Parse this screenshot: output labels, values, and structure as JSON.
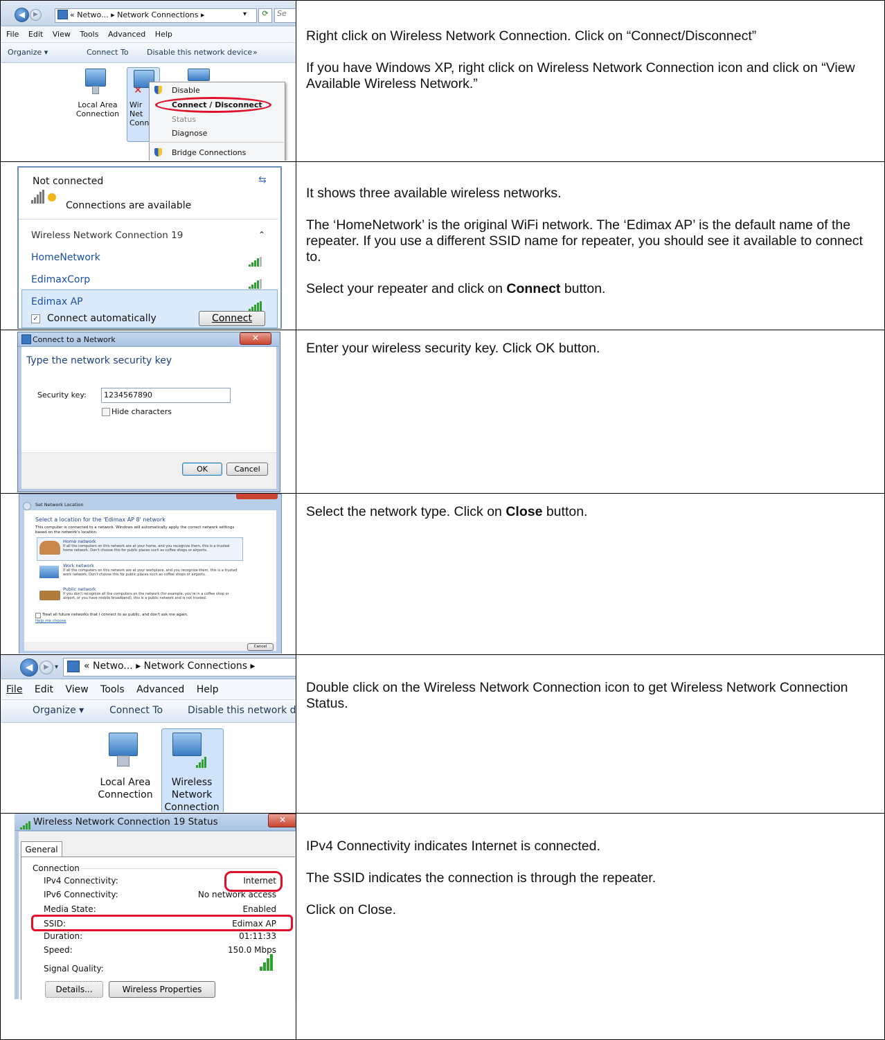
{
  "rows": [
    {
      "shot1": {
        "addr_prefix": "«",
        "addr_path1": "Netwo...",
        "addr_sep": "▸",
        "addr_path2": "Network Connections",
        "search_stub": "Se",
        "menu": [
          "File",
          "Edit",
          "View",
          "Tools",
          "Advanced",
          "Help"
        ],
        "cmd": [
          "Organize ▾",
          "Connect To",
          "Disable this network device",
          "»"
        ],
        "icon1_label": "Local Area Connection",
        "icon2_label_partial": "Wir Net Conn 1",
        "context_items": [
          "Disable",
          "Connect / Disconnect",
          "Status",
          "Diagnose",
          "Bridge Connections"
        ]
      },
      "paragraphs": [
        "Right click on Wireless Network Connection.  Click on “Connect/Disconnect”",
        "If you have Windows XP, right click on Wireless Network Connection icon and click on “View Available Wireless Network.”"
      ]
    },
    {
      "shot2": {
        "status": "Not connected",
        "available": "Connections are available",
        "section": "Wireless Network Connection 19",
        "networks": [
          "HomeNetwork",
          "EdimaxCorp",
          "Edimax AP"
        ],
        "auto_label": "Connect automatically",
        "connect_button": "Connect"
      },
      "paragraphs": [
        "It shows three available wireless networks.",
        "The ‘HomeNetwork’ is the original WiFi network.  The ‘Edimax AP’ is the default name of the repeater.  If you use a different SSID name for repeater, you should see it available to connect to."
      ],
      "last_pre": "Select your repeater and click on ",
      "last_bold": "Connect",
      "last_post": " button."
    },
    {
      "shot3": {
        "title": "Connect to a Network",
        "heading": "Type the network security key",
        "key_label": "Security key:",
        "key_value": "1234567890",
        "hide_label": "Hide characters",
        "ok": "OK",
        "cancel": "Cancel"
      },
      "paragraphs": [
        "Enter your wireless security key.  Click OK button."
      ]
    },
    {
      "shot4": {
        "title": "Set Network Location",
        "heading": "Select a location for the 'Edimax AP  8' network",
        "intro": "This computer is connected to a network. Windows will automatically apply the correct network settings based on the network's location.",
        "options": [
          {
            "name": "Home network",
            "desc": "If all the computers on this network are at your home, and you recognize them, this is a trusted home network.  Don't choose this for public places such as coffee shops or airports."
          },
          {
            "name": "Work network",
            "desc": "If all the computers on this network are at your workplace, and you recognize them, this is a trusted work network.  Don't choose this for public places such as coffee shops or airports."
          },
          {
            "name": "Public network",
            "desc": "If you don't recognize all the computers on the network (for example, you're in a coffee shop or airport, or you have mobile broadband), this is a public network and is not trusted."
          }
        ],
        "treat": "Treat all future networks that I connect to as public, and don't ask me again.",
        "help": "Help me choose",
        "cancel": "Cancel"
      },
      "text_pre": "Select the network type.  Click on ",
      "text_bold": "Close",
      "text_post": " button."
    },
    {
      "shot5": {
        "addr_prefix": "«",
        "addr_path1": "Netwo...",
        "addr_sep": "▸",
        "addr_path2": "Network Connections",
        "addr_end": "▸",
        "menu": [
          "File",
          "Edit",
          "View",
          "Tools",
          "Advanced",
          "Help"
        ],
        "cmd": [
          "Organize ▾",
          "Connect To",
          "Disable this network d"
        ],
        "icon1_label": "Local Area Connection",
        "icon2_label": "Wireless Network Connection"
      },
      "paragraphs": [
        "Double click on the Wireless Network Connection icon to get Wireless Network Connection Status."
      ]
    },
    {
      "shot6": {
        "title": "Wireless Network Connection 19 Status",
        "tab": "General",
        "group": "Connection",
        "rows": [
          {
            "k": "IPv4 Connectivity:",
            "v": "Internet"
          },
          {
            "k": "IPv6 Connectivity:",
            "v": "No network access"
          },
          {
            "k": "Media State:",
            "v": "Enabled"
          },
          {
            "k": "SSID:",
            "v": "Edimax AP"
          },
          {
            "k": "Duration:",
            "v": "01:11:33"
          },
          {
            "k": "Speed:",
            "v": "150.0 Mbps"
          }
        ],
        "signal": "Signal Quality:",
        "details": "Details...",
        "wprops": "Wireless Properties"
      },
      "paragraphs": [
        "IPv4 Connectivity indicates Internet is connected.",
        "The SSID indicates the connection is through the repeater.",
        "Click on Close."
      ]
    }
  ]
}
